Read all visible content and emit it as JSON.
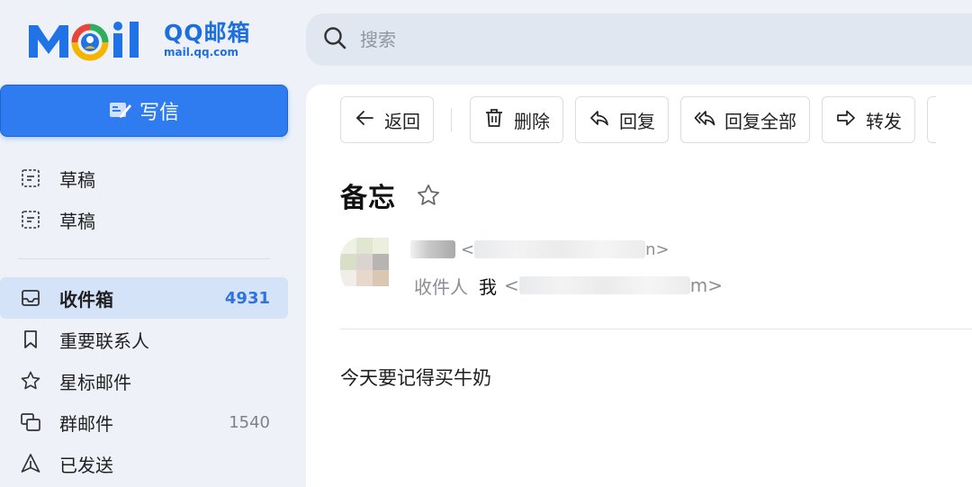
{
  "logo": {
    "mark_text": "Mail",
    "name_cn": "QQ邮箱",
    "domain": "mail.qq.com"
  },
  "search": {
    "placeholder": "搜索"
  },
  "compose": {
    "label": "写信"
  },
  "sidebar": {
    "drafts": [
      {
        "label": "草稿",
        "icon": "draft-icon"
      },
      {
        "label": "草稿",
        "icon": "draft-icon"
      }
    ],
    "folders": [
      {
        "label": "收件箱",
        "icon": "inbox-icon",
        "count": "4931",
        "active": true
      },
      {
        "label": "重要联系人",
        "icon": "bookmark-icon",
        "count": ""
      },
      {
        "label": "星标邮件",
        "icon": "star-icon",
        "count": ""
      },
      {
        "label": "群邮件",
        "icon": "group-mail-icon",
        "count": "1540"
      },
      {
        "label": "已发送",
        "icon": "send-icon",
        "count": ""
      }
    ]
  },
  "toolbar": {
    "back": "返回",
    "delete": "删除",
    "reply": "回复",
    "reply_all": "回复全部",
    "forward": "转发"
  },
  "mail": {
    "subject": "备忘",
    "from_prefix": "<",
    "from_suffix": "n>",
    "to_label": "收件人",
    "to_name": "我",
    "to_prefix": "<",
    "to_suffix": "m>",
    "body": "今天要记得买牛奶"
  },
  "colors": {
    "accent": "#2f7bf0",
    "active_bg": "#d5e3f8",
    "page_bg": "#eef2f8"
  }
}
